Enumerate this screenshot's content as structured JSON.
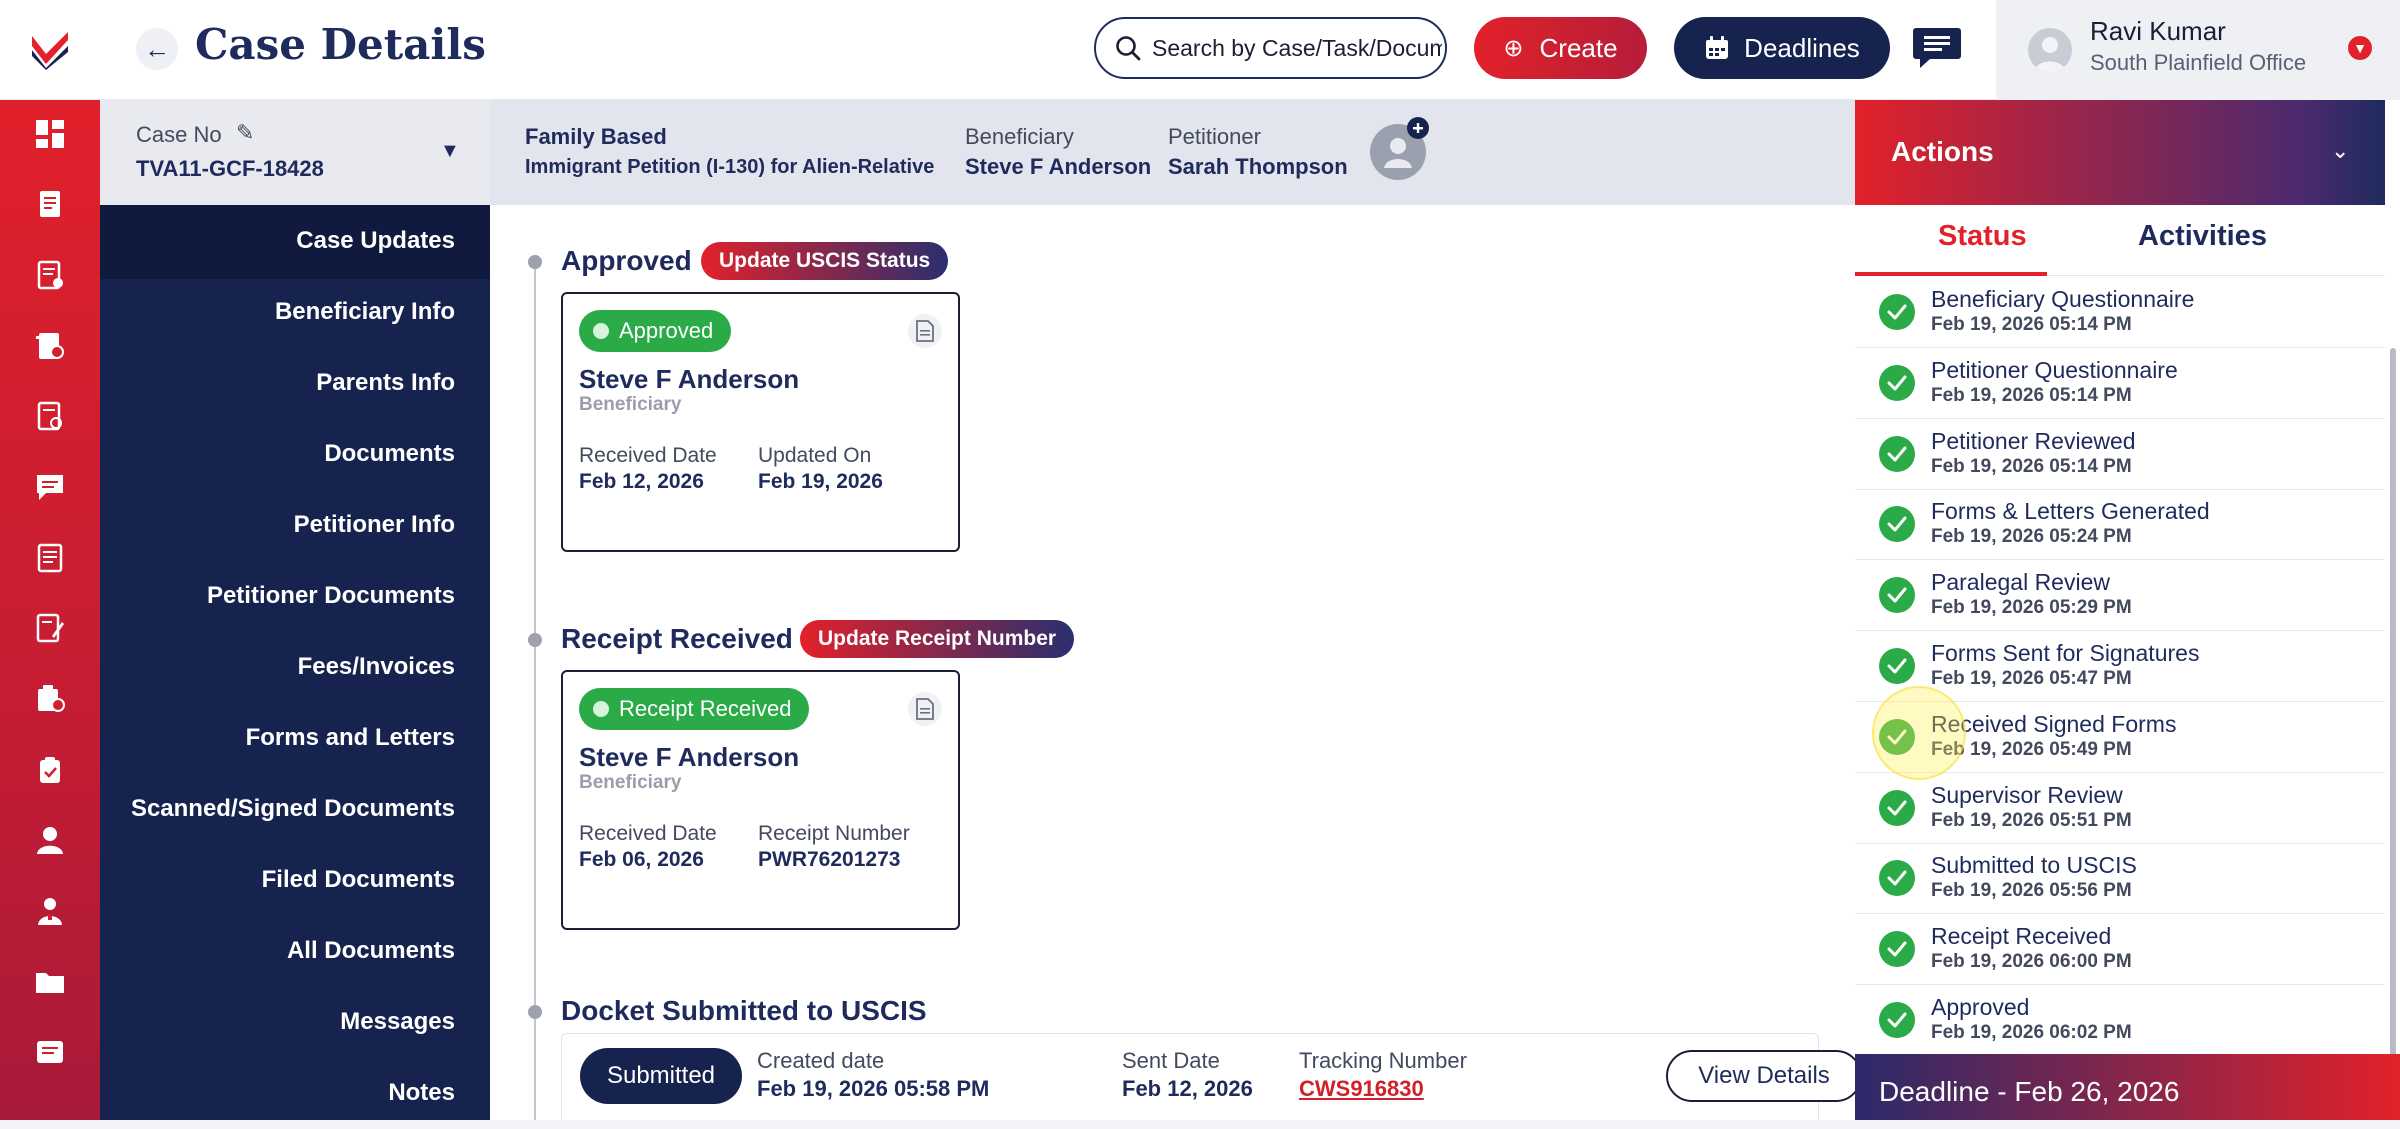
{
  "header": {
    "title": "Case Details",
    "search_placeholder": "Search by Case/Task/Document",
    "create_label": "Create",
    "deadlines_label": "Deadlines",
    "user_name": "Ravi Kumar",
    "user_office": "South Plainfield Office"
  },
  "case": {
    "case_no_label": "Case No",
    "case_no": "TVA11-GCF-18428",
    "category": "Family Based",
    "petition_type": "Immigrant Petition (I-130) for Alien-Relative",
    "beneficiary_label": "Beneficiary",
    "beneficiary": "Steve F Anderson",
    "petitioner_label": "Petitioner",
    "petitioner": "Sarah Thompson"
  },
  "sections": [
    "Case Updates",
    "Beneficiary Info",
    "Parents Info",
    "Documents",
    "Petitioner Info",
    "Petitioner Documents",
    "Fees/Invoices",
    "Forms and Letters",
    "Scanned/Signed Documents",
    "Filed Documents",
    "All Documents",
    "Messages",
    "Notes"
  ],
  "timeline": {
    "approved": {
      "title": "Approved",
      "action": "Update USCIS Status",
      "status": "Approved",
      "name": "Steve F Anderson",
      "role": "Beneficiary",
      "label_a": "Received Date",
      "value_a": "Feb 12, 2026",
      "label_b": "Updated On",
      "value_b": "Feb 19, 2026"
    },
    "receipt": {
      "title": "Receipt Received",
      "action": "Update Receipt Number",
      "status": "Receipt Received",
      "name": "Steve F Anderson",
      "role": "Beneficiary",
      "label_a": "Received Date",
      "value_a": "Feb 06, 2026",
      "label_b": "Receipt Number",
      "value_b": "PWR76201273"
    },
    "docket": {
      "title": "Docket Submitted to USCIS",
      "status": "Submitted",
      "created_label": "Created date",
      "created_value": "Feb 19, 2026 05:58 PM",
      "sent_label": "Sent Date",
      "sent_value": "Feb 12, 2026",
      "tracking_label": "Tracking Number",
      "tracking_value": "CWS916830",
      "view_label": "View Details"
    }
  },
  "actions": {
    "title": "Actions",
    "tab_status": "Status",
    "tab_activities": "Activities",
    "items": [
      {
        "name": "Beneficiary Questionnaire",
        "time": "Feb 19, 2026 05:14 PM"
      },
      {
        "name": "Petitioner Questionnaire",
        "time": "Feb 19, 2026 05:14 PM"
      },
      {
        "name": "Petitioner Reviewed",
        "time": "Feb 19, 2026 05:14 PM"
      },
      {
        "name": "Forms & Letters Generated",
        "time": "Feb 19, 2026 05:24 PM"
      },
      {
        "name": "Paralegal Review",
        "time": "Feb 19, 2026 05:29 PM"
      },
      {
        "name": "Forms Sent for Signatures",
        "time": "Feb 19, 2026 05:47 PM"
      },
      {
        "name": "Received Signed Forms",
        "time": "Feb 19, 2026 05:49 PM"
      },
      {
        "name": "Supervisor Review",
        "time": "Feb 19, 2026 05:51 PM"
      },
      {
        "name": "Submitted to USCIS",
        "time": "Feb 19, 2026 05:56 PM"
      },
      {
        "name": "Receipt Received",
        "time": "Feb 19, 2026 06:00 PM"
      },
      {
        "name": "Approved",
        "time": "Feb 19, 2026 06:02 PM"
      }
    ],
    "deadline": "Deadline - Feb 26, 2026"
  },
  "colors": {
    "brand_red": "#e2212a",
    "navy": "#16234f",
    "success_green": "#2bab48"
  },
  "icons": {
    "rail": [
      "dashboard-icon",
      "cases-icon",
      "tasks-icon",
      "billing-icon",
      "forms-icon",
      "messages-icon",
      "documents-icon",
      "notes-icon",
      "reports-icon",
      "clipboard-icon",
      "user-icon",
      "users-icon",
      "folder-icon",
      "cards-icon"
    ]
  }
}
